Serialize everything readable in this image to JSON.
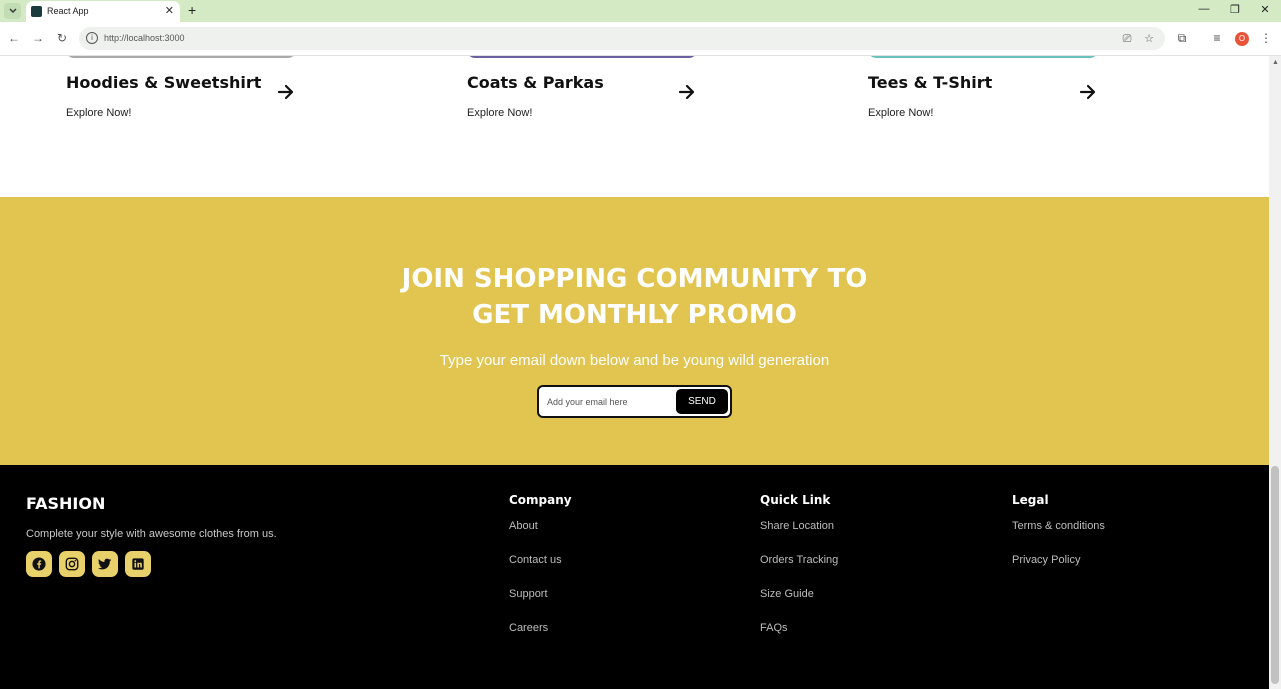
{
  "browser": {
    "tab_title": "React App",
    "url": "http://localhost:3000",
    "profile_initial": "O"
  },
  "categories": [
    {
      "title": "Hoodies & Sweetshirt",
      "cta": "Explore Now!",
      "image_edge_color": "#a9a9a9"
    },
    {
      "title": "Coats & Parkas",
      "cta": "Explore Now!",
      "image_edge_color": "#6a5fa0"
    },
    {
      "title": "Tees & T-Shirt",
      "cta": "Explore Now!",
      "image_edge_color": "#6cc2bd"
    }
  ],
  "newsletter": {
    "title_line1": "JOIN SHOPPING COMMUNITY TO",
    "title_line2": "GET MONTHLY PROMO",
    "subtitle": "Type your email down below and be young wild generation",
    "input_placeholder": "Add your email here",
    "send_label": "SEND",
    "background": "#e2c550"
  },
  "footer": {
    "brand": "FASHION",
    "tagline": "Complete your style with awesome clothes from us.",
    "socials": [
      "facebook-icon",
      "instagram-icon",
      "twitter-icon",
      "linkedin-icon"
    ],
    "columns": [
      {
        "title": "Company",
        "links": [
          "About",
          "Contact us",
          "Support",
          "Careers"
        ]
      },
      {
        "title": "Quick Link",
        "links": [
          "Share Location",
          "Orders Tracking",
          "Size Guide",
          "FAQs"
        ]
      },
      {
        "title": "Legal",
        "links": [
          "Terms & conditions",
          "Privacy Policy"
        ]
      }
    ]
  }
}
